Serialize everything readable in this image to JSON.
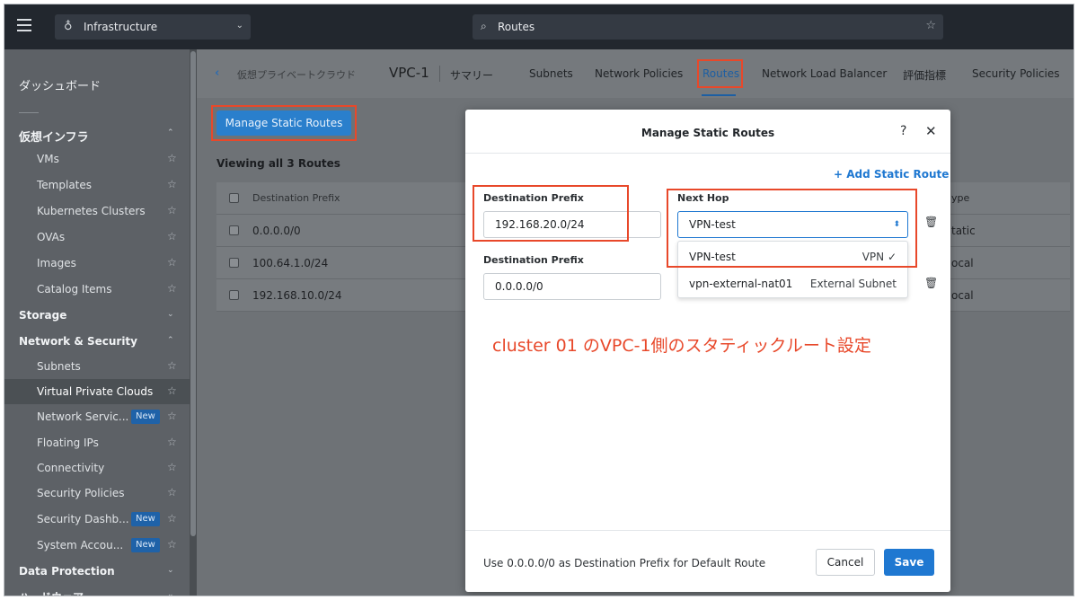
{
  "topbar": {
    "menu_icon": "hamburger-icon",
    "app_icon": "infrastructure-icon",
    "app_name": "Infrastructure",
    "search_value": "Routes",
    "search_icon": "search-icon",
    "favorite_icon": "star-icon"
  },
  "sidebar": {
    "dashboard": "ダッシュボード",
    "group_virtual_infra": "仮想インフラ",
    "virtual_infra_items": [
      {
        "label": "VMs"
      },
      {
        "label": "Templates"
      },
      {
        "label": "Kubernetes Clusters"
      },
      {
        "label": "OVAs"
      },
      {
        "label": "Images"
      },
      {
        "label": "Catalog Items"
      }
    ],
    "storage": "Storage",
    "network_security": "Network & Security",
    "network_items": [
      {
        "label": "Subnets",
        "badge": ""
      },
      {
        "label": "Virtual Private Clouds",
        "badge": ""
      },
      {
        "label": "Network Servic...",
        "badge": "New"
      },
      {
        "label": "Floating IPs",
        "badge": ""
      },
      {
        "label": "Connectivity",
        "badge": ""
      },
      {
        "label": "Security Policies",
        "badge": ""
      },
      {
        "label": "Security Dashb...",
        "badge": "New"
      },
      {
        "label": "System Accou...",
        "badge": "New"
      }
    ],
    "data_protection": "Data Protection",
    "hardware": "ハードウェア",
    "active_item": "Virtual Private Clouds"
  },
  "subnav": {
    "breadcrumb": "仮想プライベートクラウド",
    "vpc_name": "VPC-1",
    "tabs": [
      {
        "label": "サマリー"
      },
      {
        "label": "Subnets"
      },
      {
        "label": "Network Policies"
      },
      {
        "label": "Routes"
      },
      {
        "label": "Network Load Balancer"
      },
      {
        "label": "評価指標"
      },
      {
        "label": "Security Policies"
      }
    ],
    "active_tab": "Routes"
  },
  "main": {
    "manage_button": "Manage Static Routes",
    "viewing_label": "Viewing all 3 Routes",
    "table": {
      "headers": [
        "Destination Prefix",
        "Type"
      ],
      "header_type_visible": "ype",
      "rows": [
        {
          "prefix": "0.0.0.0/0",
          "type_visible": "tatic"
        },
        {
          "prefix": "100.64.1.0/24",
          "type_visible": "ocal"
        },
        {
          "prefix": "192.168.10.0/24",
          "type_visible": "ocal"
        }
      ]
    }
  },
  "modal": {
    "title": "Manage Static Routes",
    "help_icon": "?",
    "close_icon": "✕",
    "add_route": "+ Add Static Route",
    "dest_label": "Destination Prefix",
    "next_hop_label": "Next Hop",
    "routes": [
      {
        "prefix": "192.168.20.0/24",
        "next_hop": "VPN-test"
      },
      {
        "prefix": "0.0.0.0/0",
        "next_hop": ""
      }
    ],
    "dropdown_options": [
      {
        "name": "VPN-test",
        "kind": "VPN",
        "selected": true
      },
      {
        "name": "vpn-external-nat01",
        "kind": "External Subnet",
        "selected": false
      }
    ],
    "checkmark": "✓",
    "footer_hint": "Use 0.0.0.0/0 as Destination Prefix for Default Route",
    "cancel": "Cancel",
    "save": "Save"
  },
  "annotation": "cluster 01 のVPC-1側のスタティックルート設定",
  "colors": {
    "highlight": "#e8482a",
    "primary": "#1f78d1",
    "topbar": "#22272e",
    "sidebar": "#5d6166"
  }
}
